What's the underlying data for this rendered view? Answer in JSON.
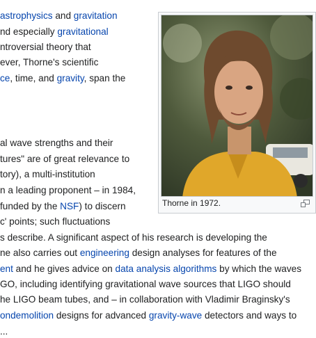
{
  "article": {
    "lines": [
      [
        {
          "t": "astrophysics",
          "l": true
        },
        {
          "t": " and ",
          "l": false
        },
        {
          "t": "gravitation",
          "l": true
        }
      ],
      [
        {
          "t": "nd especially ",
          "l": false
        },
        {
          "t": "gravitational",
          "l": true
        }
      ],
      [
        {
          "t": "ntroversial theory that",
          "l": false
        }
      ],
      [
        {
          "t": "ever, Thorne's scientific",
          "l": false
        }
      ],
      [
        {
          "t": "ce",
          "l": true
        },
        {
          "t": ", time, and ",
          "l": false
        },
        {
          "t": "gravity",
          "l": true
        },
        {
          "t": ", span the",
          "l": false
        }
      ],
      [
        {
          "t": "al wave strengths and their",
          "l": false
        }
      ],
      [
        {
          "t": "tures\" are of great relevance to",
          "l": false
        }
      ],
      [
        {
          "t": "tory), a multi-institution",
          "l": false
        }
      ],
      [
        {
          "t": "n a leading proponent – in 1984,",
          "l": false
        }
      ],
      [
        {
          "t": "funded by the ",
          "l": false
        },
        {
          "t": "NSF",
          "l": true
        },
        {
          "t": ") to discern",
          "l": false
        }
      ],
      [
        {
          "t": "c' points; such fluctuations",
          "l": false
        }
      ],
      [
        {
          "t": "s describe. A significant aspect of his research is developing the",
          "l": false
        }
      ],
      [
        {
          "t": "ne also carries out ",
          "l": false
        },
        {
          "t": "engineering",
          "l": true
        },
        {
          "t": " design analyses for features of the",
          "l": false
        }
      ],
      [
        {
          "t": "ent",
          "l": true
        },
        {
          "t": " and he gives advice on ",
          "l": false
        },
        {
          "t": "data analysis algorithms",
          "l": true
        },
        {
          "t": " by which the waves",
          "l": false
        }
      ],
      [
        {
          "t": "GO, including identifying gravitational wave sources that LIGO should",
          "l": false
        }
      ],
      [
        {
          "t": "he LIGO beam tubes, and – in collaboration with Vladimir Braginsky's",
          "l": false
        }
      ],
      [
        {
          "t": "ondemolition",
          "l": true
        },
        {
          "t": " designs for advanced ",
          "l": false
        },
        {
          "t": "gravity-wave",
          "l": true
        },
        {
          "t": " detectors and ways to",
          "l": false
        }
      ],
      [
        {
          "t": "...",
          "l": false
        }
      ]
    ]
  },
  "figure": {
    "caption": "Thorne in 1972.",
    "enlarge_icon": "magnify-clip-icon"
  },
  "colors": {
    "link": "#0645ad",
    "text": "#202122",
    "border": "#c8ccd1"
  }
}
